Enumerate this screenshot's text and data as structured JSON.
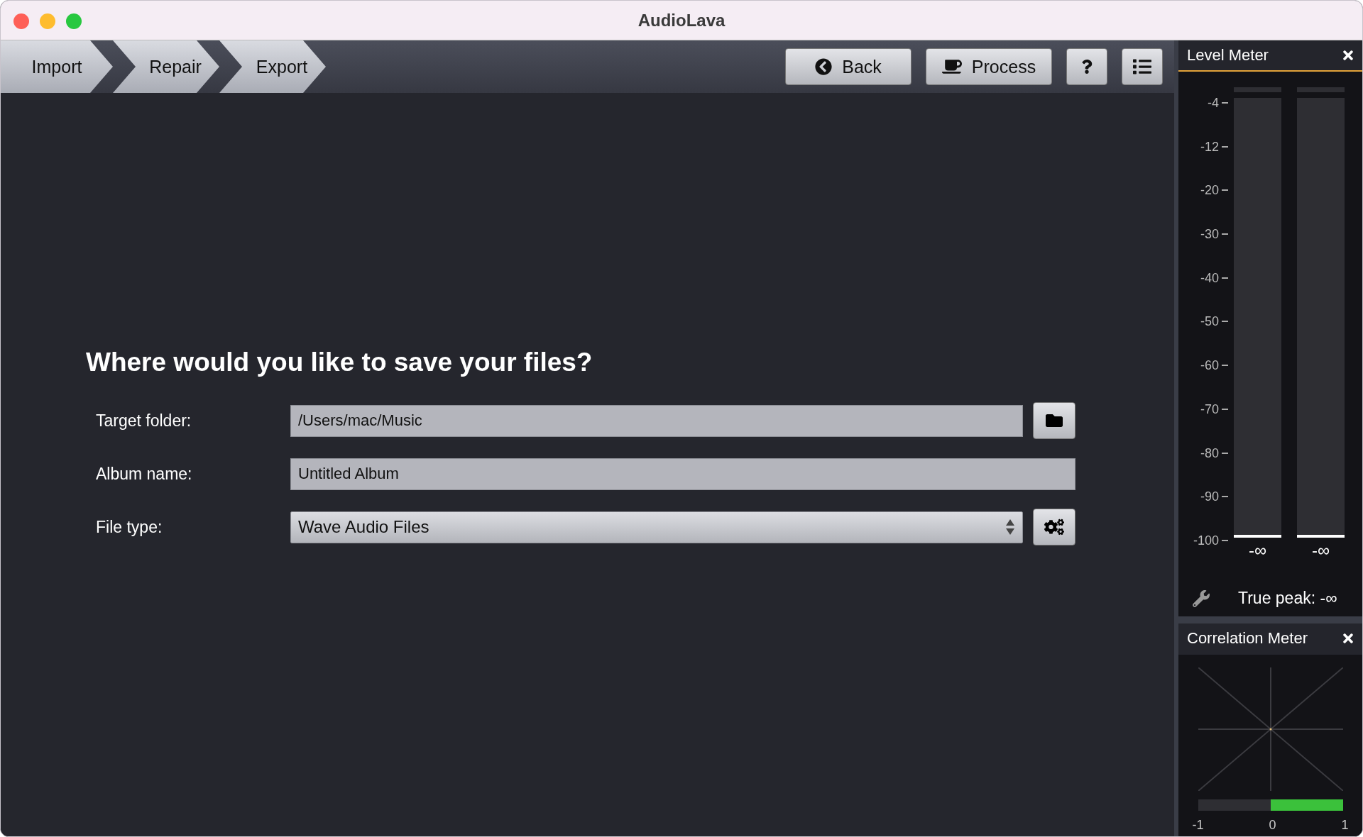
{
  "window": {
    "title": "AudioLava"
  },
  "steps": [
    {
      "label": "Import"
    },
    {
      "label": "Repair"
    },
    {
      "label": "Export"
    }
  ],
  "toolbar": {
    "buttons": [
      {
        "kind": "back",
        "label": "Back"
      },
      {
        "kind": "process",
        "label": "Process"
      },
      {
        "kind": "help"
      },
      {
        "kind": "list"
      }
    ]
  },
  "form": {
    "heading": "Where would you like to save your files?",
    "fields": [
      {
        "kind": "folder",
        "label": "Target folder:",
        "value": "/Users/mac/Music"
      },
      {
        "kind": "text",
        "label": "Album name:",
        "value": "Untitled Album"
      },
      {
        "kind": "select",
        "label": "File type:",
        "value": "Wave Audio Files"
      }
    ]
  },
  "level_meter": {
    "title": "Level Meter",
    "scale": [
      "-4",
      "-12",
      "-20",
      "-30",
      "-40",
      "-50",
      "-60",
      "-70",
      "-80",
      "-90",
      "-100"
    ],
    "channels": [
      {
        "level": 0,
        "reading": "-∞"
      },
      {
        "level": 0,
        "reading": "-∞"
      }
    ],
    "true_peak": "True peak: -∞"
  },
  "correlation_meter": {
    "title": "Correlation Meter",
    "level": 0.5,
    "ticks": [
      "-1",
      "0",
      "1"
    ]
  }
}
